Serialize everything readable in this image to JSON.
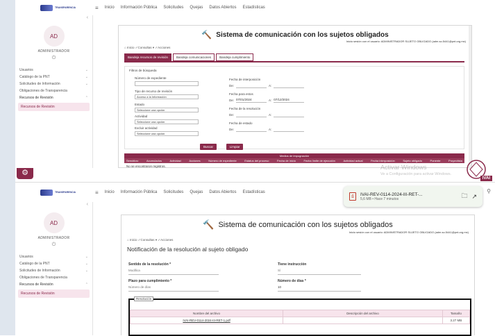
{
  "top": {
    "logo_text": "TRANSPARENCIA",
    "menu": [
      "Inicio",
      "Información Pública",
      "Solicitudes",
      "Quejas",
      "Datos Abiertos",
      "Estadísticas"
    ]
  },
  "sidebar": {
    "avatar": "AD",
    "role": "ADMINISTRADOR",
    "items": [
      {
        "label": "Usuarios"
      },
      {
        "label": "Catálogo de la PNT"
      },
      {
        "label": "Solicitudes de Información"
      },
      {
        "label": "Obligaciones de Transparencia"
      },
      {
        "label": "Recursos de Revisión"
      }
    ],
    "active_item": "Recursos de Revisión"
  },
  "upper": {
    "title": "Sistema de comunicación con los sujetos obligados",
    "user_line": "Inicio sesión con el usuario: ADMINISTRADOR SUJETO OBLIGADO (adm.so.5441@pnt.org.mx)",
    "breadcrumb": [
      "Inicio",
      "Consultas",
      "Acciones"
    ],
    "tabs": [
      "Bandeja recursos de revisión",
      "Bandeja comunicaciones",
      "Bandeja cumplimiento"
    ],
    "filter_title": "Filtros de búsqueda",
    "left_fields": [
      {
        "label": "Número de expediente",
        "value": ""
      },
      {
        "label": "Tipo de recurso de revisión",
        "value": "Acceso a la Información"
      },
      {
        "label": "Estado",
        "value": "Seleccione una opción"
      },
      {
        "label": "Actividad",
        "value": "Seleccione una opción"
      },
      {
        "label": "Excluir actividad",
        "value": "Seleccione una opción"
      }
    ],
    "right_fields": [
      {
        "label": "Fecha de interposición",
        "from": "",
        "to": ""
      },
      {
        "label": "Fecha para estos",
        "from": "07/01/2024",
        "to": "07/12/2024"
      },
      {
        "label": "Fecha de la resolución",
        "from": "",
        "to": ""
      },
      {
        "label": "Fecha de estado",
        "from": "",
        "to": ""
      }
    ],
    "de_label": "De:",
    "a_label": "A:",
    "search_btn": "Buscar",
    "clear_btn": "Limpiar",
    "table_group_header": "Medios de impugnación",
    "table_columns": [
      "Semáforo",
      "Acumulados",
      "Actividad",
      "Acciones",
      "Número de expediente",
      "Estatus del proceso",
      "Fecha de inicio",
      "Fecha límite de ejecución",
      "Actividad actual",
      "Fecha interposición",
      "Sujeto obligado",
      "Ponente",
      "Proyectista"
    ],
    "empty_msg": "No se encontraron registros."
  },
  "watermark": {
    "line1": "Activar Windows",
    "line2": "Ve a Configuración para activar Windows."
  },
  "ivai_badge": "IVAI",
  "download": {
    "filename": "IVAI-REV-0114-2024-III-RET-...",
    "meta": "5,6 MB • Hace 7 minutos"
  },
  "lower": {
    "title": "Sistema de comunicación con los sujetos obligados",
    "user_line": "Inicio sesión con el usuario: ADMINISTRADOR SUJETO OBLIGADO (adm.so.5441@pnt.org.mx)",
    "breadcrumb": [
      "Inicio",
      "Consultas",
      "Acciones"
    ],
    "heading": "Notificación de la resolución al sujeto obligado",
    "fields": [
      {
        "label": "Sentido de la resolución *",
        "value": "Modifica"
      },
      {
        "label": "Tiene instrucción",
        "value": "Sí"
      },
      {
        "label": "Plazo para cumplimiento *",
        "value": "Número de días"
      },
      {
        "label": "Número de días *",
        "value": "10"
      }
    ],
    "legend": "Resolución",
    "file_columns": [
      "Nombre del archivo",
      "Descripción del archivo",
      "Tamaño"
    ],
    "file_row": {
      "name": "IVAI-REV-0114-2024-III-RET-1.pdf",
      "description": "",
      "size": "3.27 MB"
    }
  },
  "colors": {
    "accent": "#8a2a4b",
    "accent_light": "#f7e4ec"
  }
}
